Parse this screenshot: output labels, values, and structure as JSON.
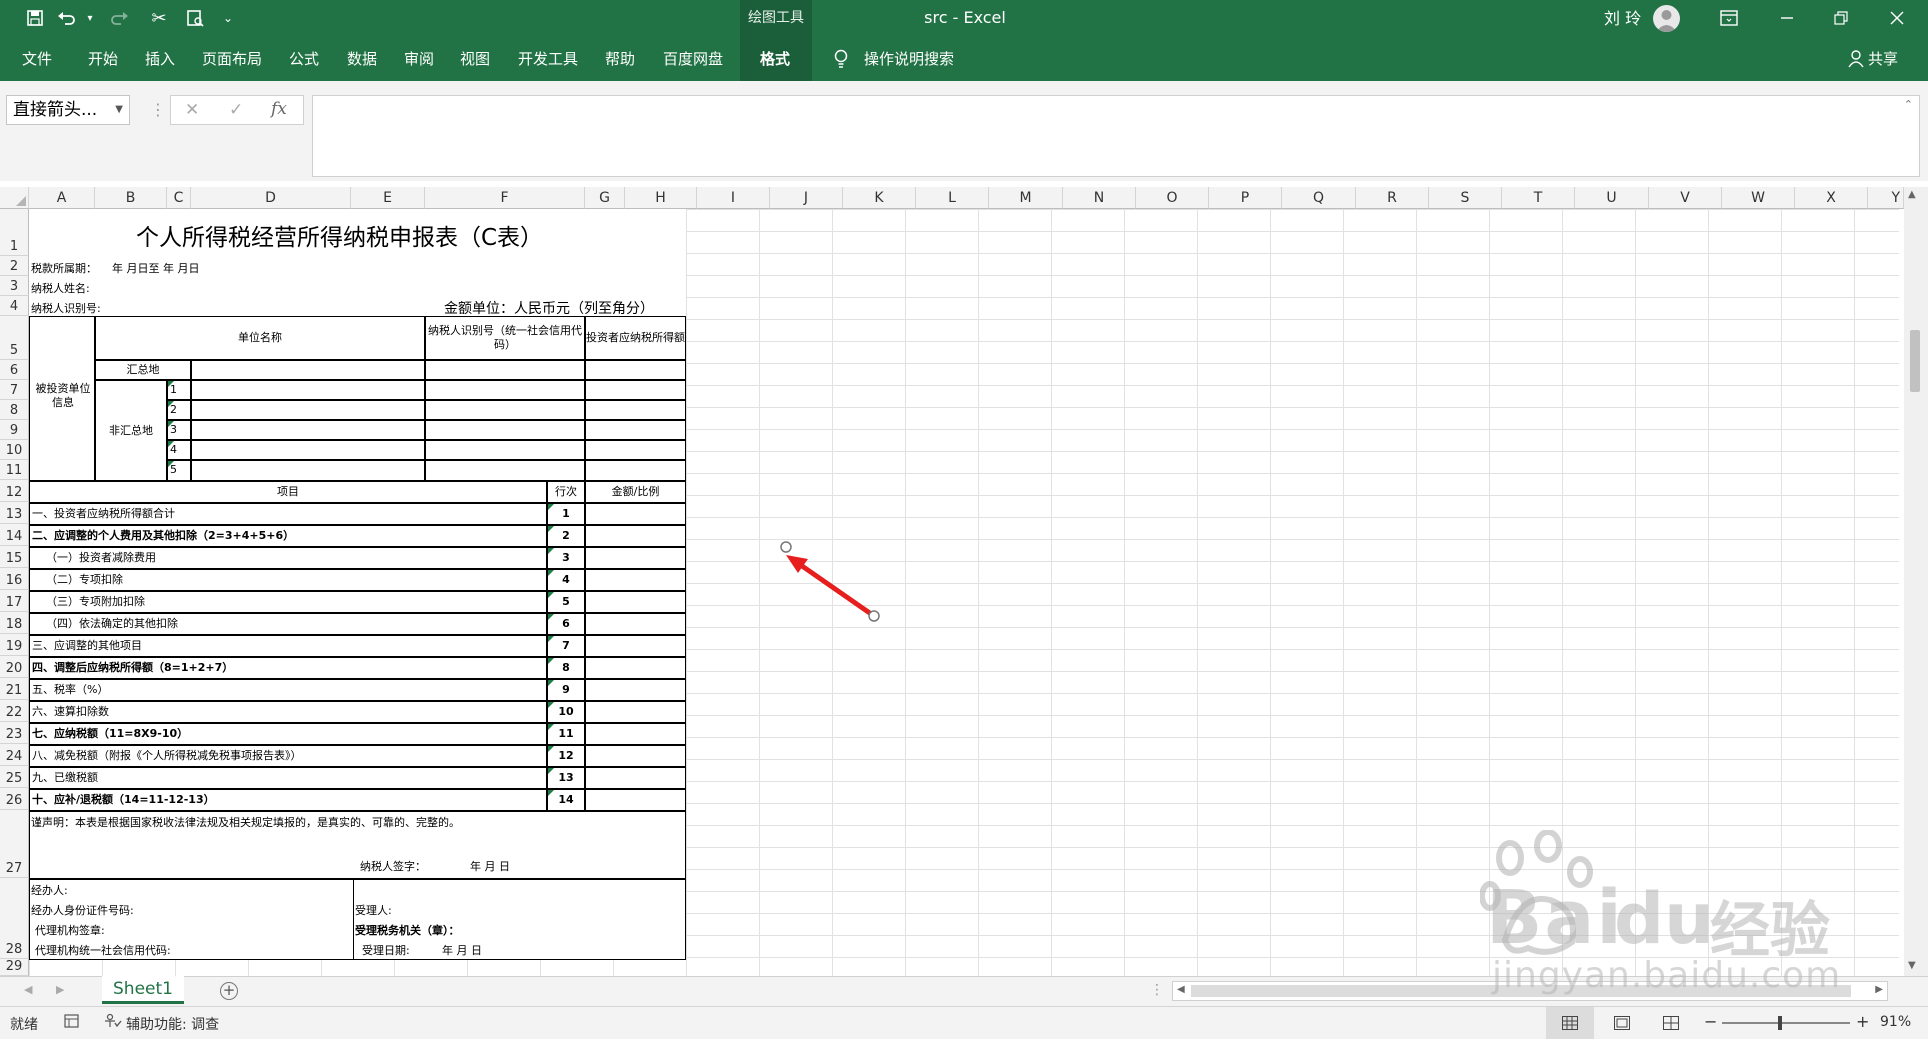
{
  "window": {
    "title": "src  -  Excel",
    "contextual_group": "绘图工具",
    "user": "刘 玲"
  },
  "ribbon": {
    "tabs": [
      "文件",
      "开始",
      "插入",
      "页面布局",
      "公式",
      "数据",
      "审阅",
      "视图",
      "开发工具",
      "帮助",
      "百度网盘",
      "格式"
    ],
    "active_tab": "格式",
    "search_label": "操作说明搜索",
    "share_label": "共享"
  },
  "formula_bar": {
    "name_box": "直接箭头...",
    "fx": "fx",
    "content": ""
  },
  "columns": [
    "A",
    "B",
    "C",
    "D",
    "E",
    "F",
    "G",
    "H",
    "I",
    "J",
    "K",
    "L",
    "M",
    "N",
    "O",
    "P",
    "Q",
    "R",
    "S",
    "T",
    "U",
    "V",
    "W",
    "X",
    "Y"
  ],
  "rows": [
    "1",
    "2",
    "3",
    "4",
    "5",
    "6",
    "7",
    "8",
    "9",
    "10",
    "11",
    "12",
    "13",
    "14",
    "15",
    "16",
    "17",
    "18",
    "19",
    "20",
    "21",
    "22",
    "23",
    "24",
    "25",
    "26",
    "27",
    "28",
    "29"
  ],
  "form": {
    "title": "个人所得税经营所得纳税申报表（C表）",
    "period_label": "税款所属期：",
    "period_value": "年 月日至 年 月日",
    "taxpayer_name_label": "纳税人姓名:",
    "taxpayer_id_label": "纳税人识别号:",
    "currency_unit": "金额单位：人民币元（列至角分）",
    "unit_name_header": "单位名称",
    "unit_id_header": "纳税人识别号（统一社会信用代码）",
    "investor_income_header": "投资者应纳税所得额",
    "invested_unit_info": "被投资单位信息",
    "summary_place": "汇总地",
    "non_summary_place": "非汇总地",
    "non_summary_rows": [
      "1",
      "2",
      "3",
      "4",
      "5"
    ],
    "item_header": "项目",
    "line_header": "行次",
    "amount_header": "金额/比例",
    "items": [
      {
        "label": "一、投资者应纳税所得额合计",
        "line": "1"
      },
      {
        "label": "二、应调整的个人费用及其他扣除（2=3+4+5+6）",
        "line": "2"
      },
      {
        "label": "（一）投资者减除费用",
        "line": "3"
      },
      {
        "label": "（二）专项扣除",
        "line": "4"
      },
      {
        "label": "（三）专项附加扣除",
        "line": "5"
      },
      {
        "label": "（四）依法确定的其他扣除",
        "line": "6"
      },
      {
        "label": "三、应调整的其他项目",
        "line": "7"
      },
      {
        "label": "四、调整后应纳税所得额（8=1+2+7）",
        "line": "8"
      },
      {
        "label": "五、税率（%）",
        "line": "9"
      },
      {
        "label": "六、速算扣除数",
        "line": "10"
      },
      {
        "label": "七、应纳税额（11=8X9-10）",
        "line": "11"
      },
      {
        "label": "八、减免税额（附报《个人所得税减免税事项报告表》）",
        "line": "12"
      },
      {
        "label": "九、已缴税额",
        "line": "13"
      },
      {
        "label": "十、应补/退税额（14=11-12-13）",
        "line": "14"
      }
    ],
    "declaration": "谨声明：本表是根据国家税收法律法规及相关规定填报的，是真实的、可靠的、完整的。",
    "signature_label": "纳税人签字：",
    "signature_date": "年 月 日",
    "agent_label": "经办人:",
    "agent_id_label": "经办人身份证件号码:",
    "agency_seal_label": "代理机构签章:",
    "agency_code_label": "代理机构统一社会信用代码:",
    "receiver_label": "受理人:",
    "tax_office_label": "受理税务机关（章）：",
    "receive_date_label": "受理日期:",
    "receive_date_value": "年 月 日"
  },
  "sheet_tabs": [
    "Sheet1"
  ],
  "status": {
    "ready": "就绪",
    "accessibility": "辅助功能: 调查",
    "zoom": "91%"
  },
  "watermark": {
    "brand": "Bai",
    "brand2": "du",
    "sub": "经验",
    "url": "jingyan.baidu.com"
  },
  "arrow_color": "#e61e1e",
  "accent_color": "#217346"
}
